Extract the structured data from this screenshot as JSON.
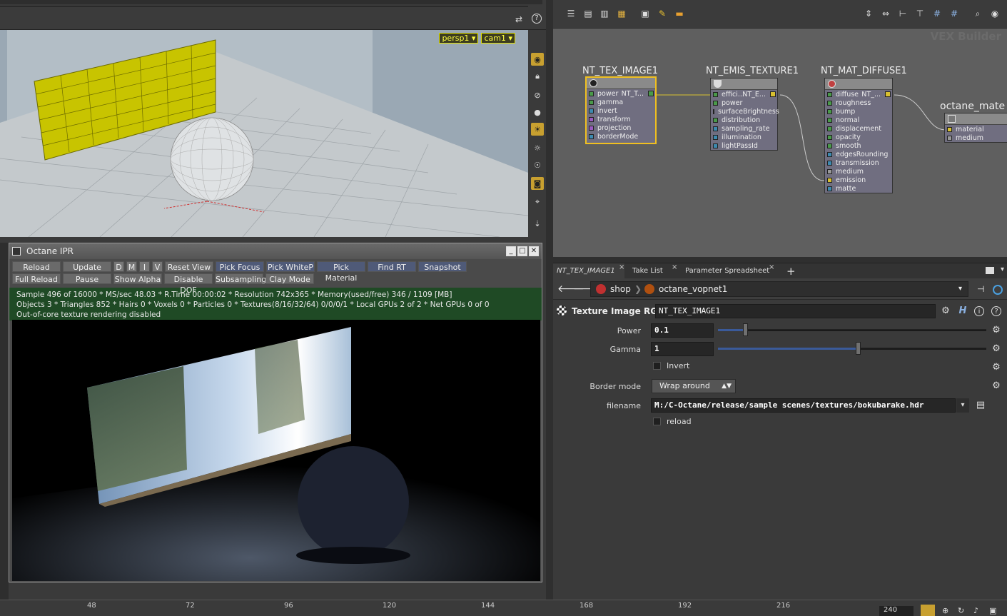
{
  "viewport": {
    "camera_menus": [
      "persp1",
      "cam1"
    ]
  },
  "ipr": {
    "title": "Octane IPR",
    "row1": [
      "Reload",
      "Update",
      "D",
      "M",
      "I",
      "V",
      "Reset View",
      "Pick Focus",
      "Pick WhiteP",
      "Pick Material",
      "Find RT",
      "Snapshot"
    ],
    "row2": [
      "Full Reload",
      "Pause",
      "Show Alpha",
      "Disable DOF",
      "Subsampling",
      "Clay Mode"
    ],
    "status": [
      "Sample 496 of 16000 * MS/sec 48.03 * R.Time 00:00:02 * Resolution 742x365 * Memory(used/free) 346 / 1109 [MB]",
      "Objects 3 * Triangles 852 * Hairs 0 * Voxels 0 * Particles 0 * Textures(8/16/32/64) 0/0/0/1 * Local GPUs 2 of 2 * Net GPUs 0 of 0",
      "Out-of-core texture rendering disabled"
    ]
  },
  "network": {
    "watermark": "VEX Builder",
    "nodes": [
      {
        "title": "NT_TEX_IMAGE1",
        "out_label": "NT_T...",
        "ports": [
          "power",
          "gamma",
          "invert",
          "transform",
          "projection",
          "borderMode"
        ]
      },
      {
        "title": "NT_EMIS_TEXTURE1",
        "out_label": "NT_E...",
        "ports": [
          "effici...",
          "power",
          "surfaceBrightness",
          "distribution",
          "sampling_rate",
          "illumination",
          "lightPassId"
        ]
      },
      {
        "title": "NT_MAT_DIFFUSE1",
        "out_label": "NT_...",
        "ports": [
          "diffuse",
          "roughness",
          "bump",
          "normal",
          "displacement",
          "opacity",
          "smooth",
          "edgesRounding",
          "transmission",
          "medium",
          "emission",
          "matte"
        ]
      },
      {
        "title": "octane_mate",
        "ports": [
          "material",
          "medium"
        ]
      }
    ]
  },
  "tabs": [
    "NT_TEX_IMAGE1",
    "Take List",
    "Parameter Spreadsheet"
  ],
  "path": {
    "root": "shop",
    "child": "octane_vopnet1"
  },
  "params": {
    "node_type": "Texture Image RGB",
    "node_name": "NT_TEX_IMAGE1",
    "power_label": "Power",
    "power_value": "0.1",
    "power_fraction": 0.1,
    "gamma_label": "Gamma",
    "gamma_value": "1",
    "gamma_fraction": 0.52,
    "invert_label": "Invert",
    "border_label": "Border mode",
    "border_value": "Wrap around",
    "filename_label": "filename",
    "filename_value": "M:/C-Octane/release/sample scenes/textures/bokubarake.hdr",
    "reload_label": "reload"
  },
  "timeline": {
    "ticks": [
      "48",
      "72",
      "96",
      "120",
      "144",
      "168",
      "192",
      "216"
    ],
    "frame": "240"
  },
  "colors": {
    "selection": "#f0c020",
    "status_bg": "#1f4a25"
  }
}
